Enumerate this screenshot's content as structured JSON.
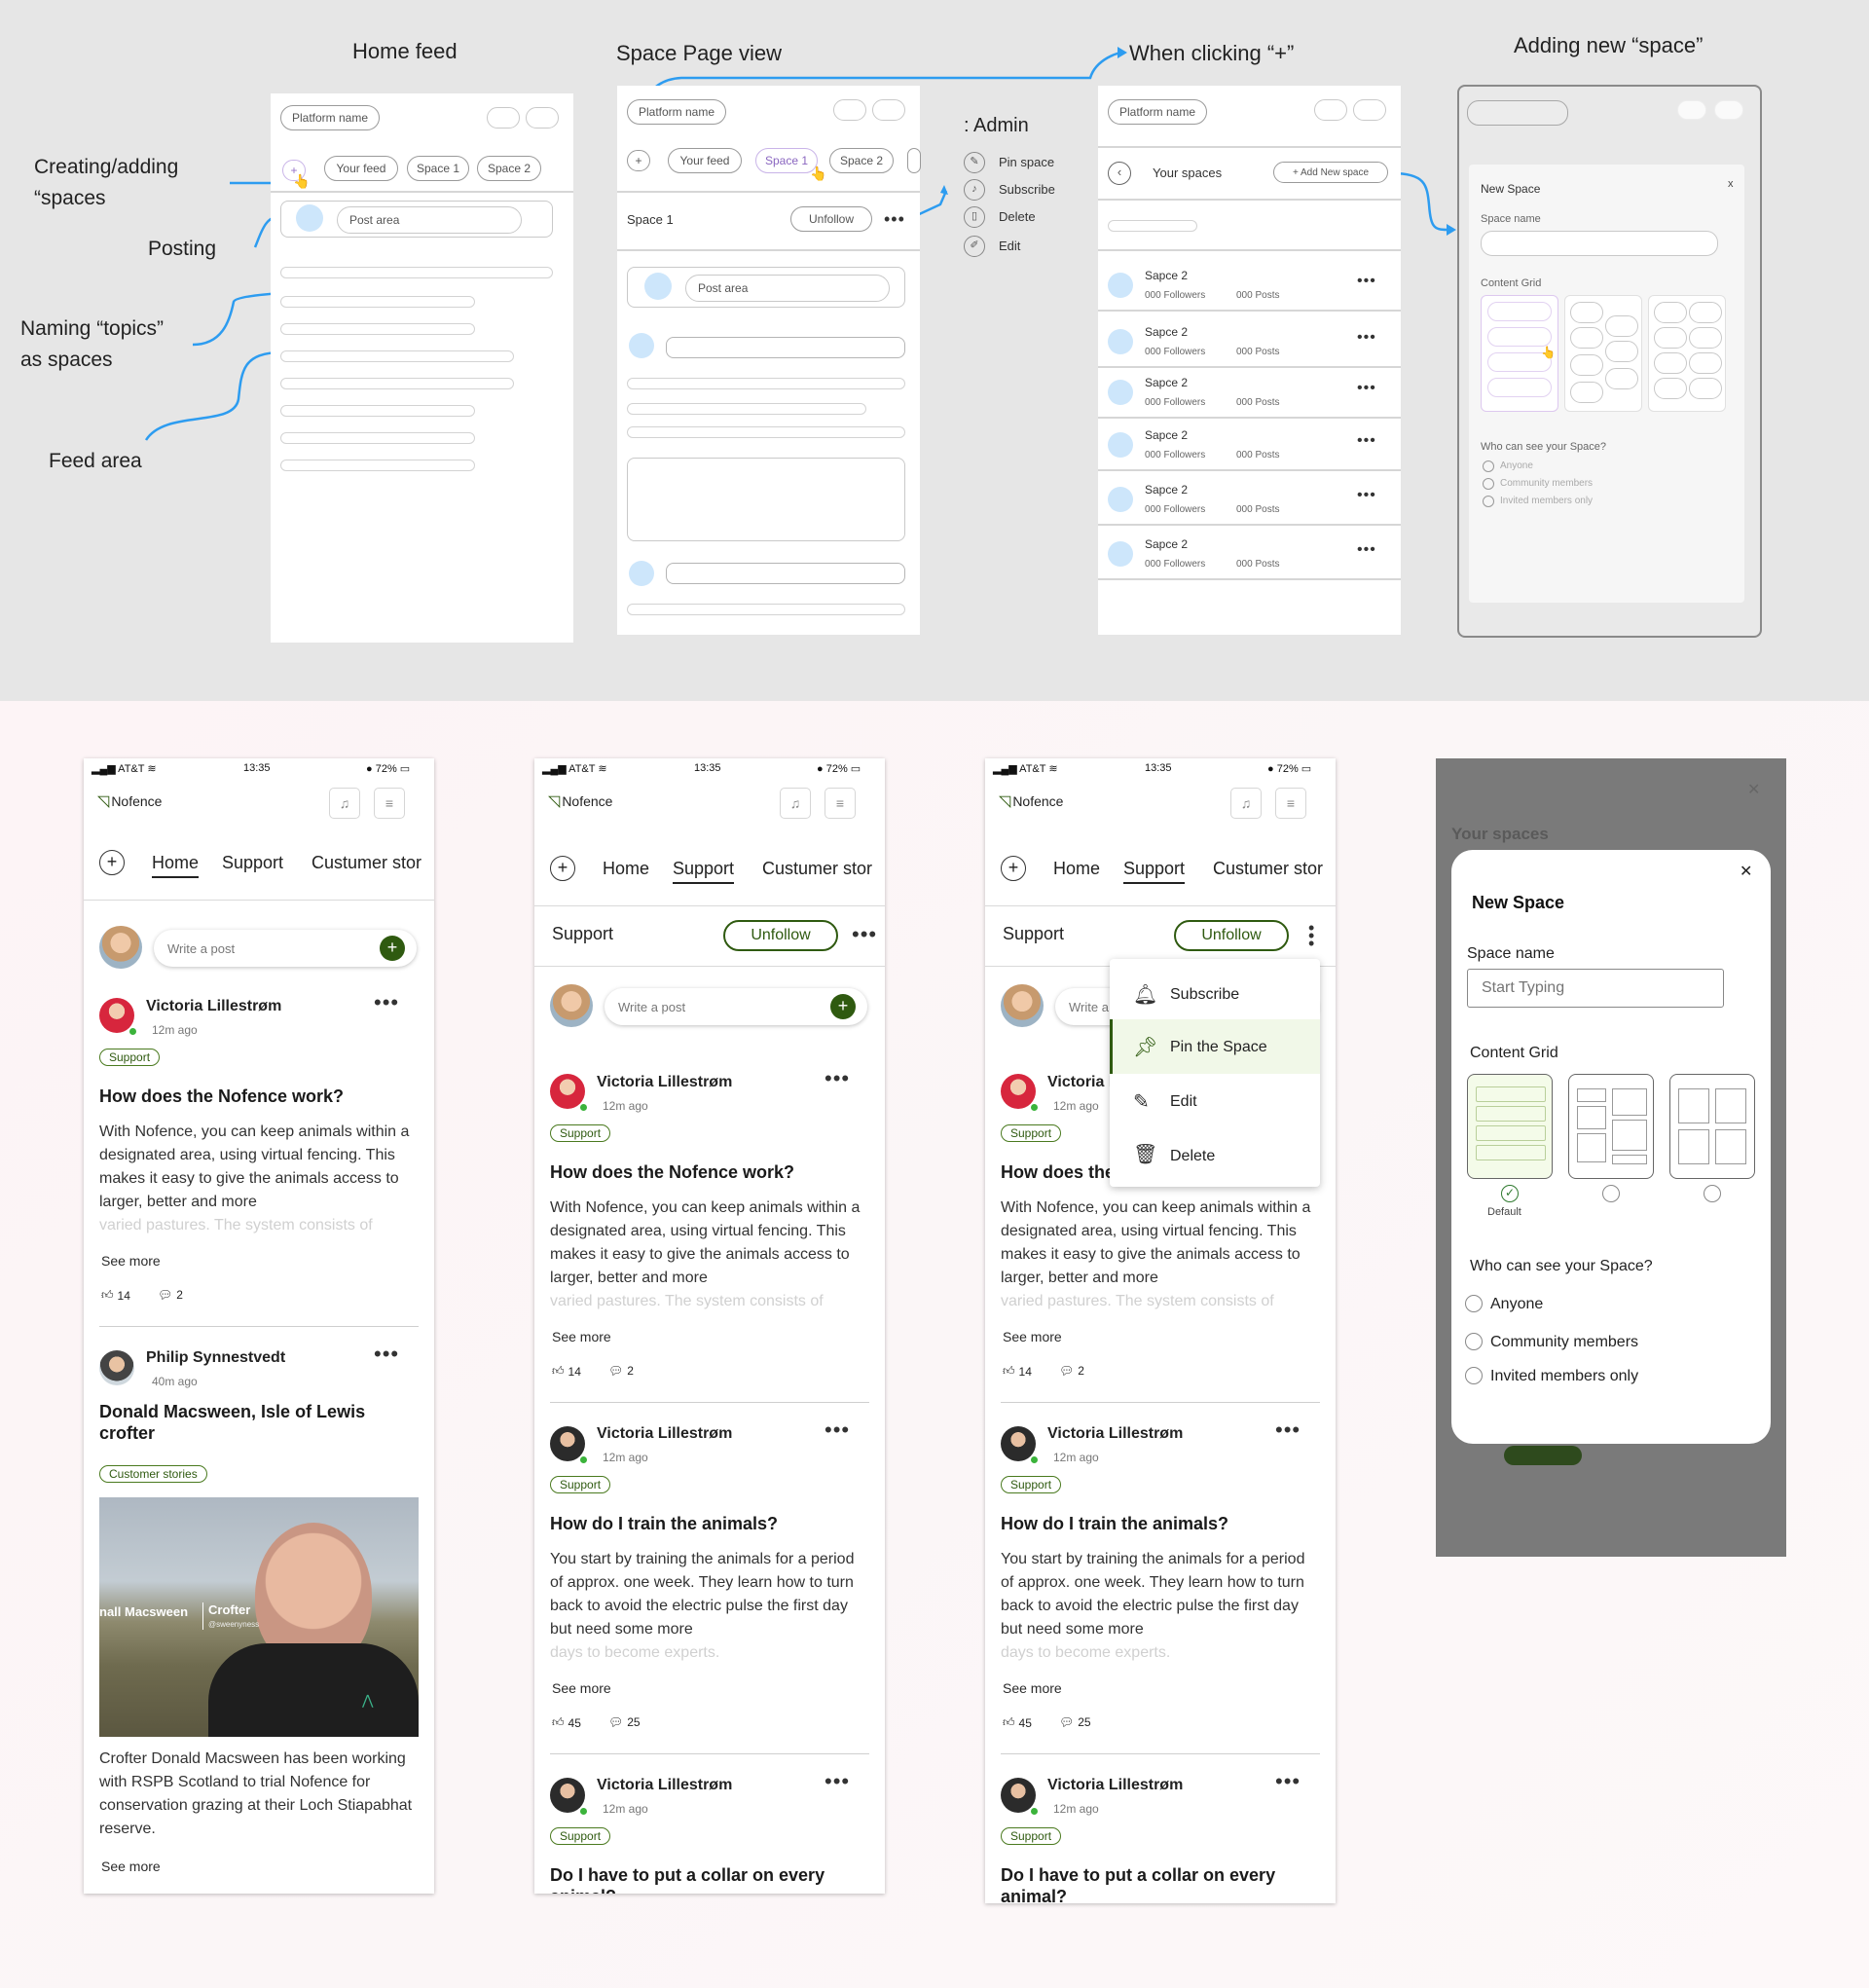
{
  "wireframes": {
    "titles": {
      "home": "Home feed",
      "space": "Space Page view",
      "plus": "When clicking “+”",
      "adding": "Adding new “space”"
    },
    "annotations": {
      "creating_1": "Creating/adding",
      "creating_2": "“spaces",
      "posting": "Posting",
      "naming_1": "Naming “topics”",
      "naming_2": "as spaces",
      "feed": "Feed area"
    },
    "home": {
      "platform": "Platform name",
      "plus": "+",
      "your_feed": "Your feed",
      "space1": "Space 1",
      "space2": "Space 2",
      "post_area": "Post area"
    },
    "space": {
      "platform": "Platform name",
      "plus": "+",
      "your_feed": "Your feed",
      "space1": "Space 1",
      "space2": "Space 2",
      "space_title": "Space 1",
      "unfollow": "Unfollow",
      "post_area": "Post area"
    },
    "admin": {
      "title": ": Admin",
      "items": [
        "Pin space",
        "Subscribe",
        "Delete",
        "Edit"
      ]
    },
    "plus": {
      "platform": "Platform name",
      "your_spaces": "Your spaces",
      "add_new": "+ Add New space",
      "rows": [
        {
          "name": "Sapce 2",
          "followers": "000 Followers",
          "posts": "000 Posts"
        },
        {
          "name": "Sapce 2",
          "followers": "000 Followers",
          "posts": "000 Posts"
        },
        {
          "name": "Sapce 2",
          "followers": "000 Followers",
          "posts": "000 Posts"
        },
        {
          "name": "Sapce 2",
          "followers": "000 Followers",
          "posts": "000 Posts"
        },
        {
          "name": "Sapce 2",
          "followers": "000 Followers",
          "posts": "000 Posts"
        },
        {
          "name": "Sapce 2",
          "followers": "000 Followers",
          "posts": "000 Posts"
        }
      ]
    },
    "adding": {
      "title": "New Space",
      "close": "x",
      "space_name": "Space name",
      "content_grid": "Content Grid",
      "who": "Who can see your Space?",
      "options": [
        "Anyone",
        "Community members",
        "Invited members only"
      ]
    }
  },
  "status": {
    "carrier": "AT&T",
    "time": "13:35",
    "battery": "72%"
  },
  "brand": "Nofence",
  "nav": {
    "home": "Home",
    "support": "Support",
    "customer": "Custumer stor"
  },
  "write_post": "Write a post",
  "space_header": {
    "title": "Support",
    "unfollow": "Unfollow"
  },
  "dropdown": {
    "subscribe": "Subscribe",
    "pin": "Pin the Space",
    "edit": "Edit",
    "delete": "Delete"
  },
  "posts": {
    "p1": {
      "author": "Victoria Lillestrøm",
      "time": "12m ago",
      "badge": "Support",
      "title": "How does the Nofence work?",
      "body": "With Nofence, you can keep animals within a designated area, using virtual fencing. This makes it easy to give the animals access to larger, better and more",
      "fade": "varied pastures. The system consists of",
      "see_more": "See more",
      "likes": "14",
      "comments": "2"
    },
    "p2": {
      "author": "Philip Synnestvedt",
      "time": "40m ago",
      "badge": "Customer stories",
      "title": "Donald Macsween, Isle of Lewis crofter",
      "image_caption_name": "nall Macsween",
      "image_caption_role": "Crofter",
      "image_caption_handle": "@sweenyness",
      "body": "Crofter Donald Macsween has been working with RSPB Scotland to trial Nofence for conservation grazing at their Loch Stiapabhat reserve.",
      "see_more": "See more"
    },
    "p3": {
      "author": "Victoria Lillestrøm",
      "time": "12m ago",
      "badge": "Support",
      "title": "How do I train the animals?",
      "body": "You start by training the animals for a period of approx. one week. They learn how to turn back to avoid the electric pulse the first day but need some more",
      "fade": "days to become experts.",
      "see_more": "See more",
      "likes": "45",
      "comments": "25"
    },
    "p4": {
      "author": "Victoria Lillestrøm",
      "time": "12m ago",
      "badge": "Support",
      "title": "Do I have to put a collar on every animal?"
    }
  },
  "modal": {
    "bg_title": "Your spaces",
    "title": "New Space",
    "space_name_label": "Space name",
    "space_name_placeholder": "Start Typing",
    "content_grid": "Content Grid",
    "default": "Default",
    "who": "Who can see your Space?",
    "options": [
      "Anyone",
      "Community members",
      "Invited members only"
    ]
  },
  "colors": {
    "accent": "#2f5a10",
    "wire_blue": "#2d9cf0",
    "avatar_blue": "#cde6fb"
  }
}
